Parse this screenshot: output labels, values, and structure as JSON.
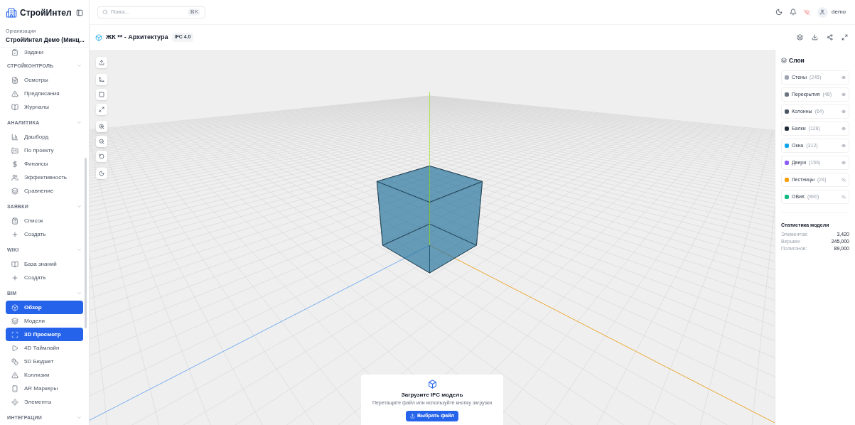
{
  "app": {
    "name": "СтройИнтел"
  },
  "search": {
    "placeholder": "Поиск...",
    "shortcut": "⌘K"
  },
  "user": {
    "name": "demo"
  },
  "organization": {
    "label": "Организация",
    "name": "СтройИнтел Демо (Минц..."
  },
  "sidebar": {
    "top_items": [
      {
        "label": "Задачи",
        "selected": false
      }
    ],
    "sections": [
      {
        "title": "СТРОЙКОНТРОЛЬ",
        "expanded": true,
        "items": [
          {
            "label": "Осмотры",
            "selected": false
          },
          {
            "label": "Предписания",
            "selected": false
          },
          {
            "label": "Журналы",
            "selected": false
          }
        ]
      },
      {
        "title": "АНАЛИТИКА",
        "expanded": true,
        "items": [
          {
            "label": "Дашборд",
            "selected": false
          },
          {
            "label": "По проекту",
            "selected": false
          },
          {
            "label": "Финансы",
            "selected": false
          },
          {
            "label": "Эффективность",
            "selected": false
          },
          {
            "label": "Сравнение",
            "selected": false
          }
        ]
      },
      {
        "title": "ЗАЯВКИ",
        "expanded": true,
        "items": [
          {
            "label": "Список",
            "selected": false
          },
          {
            "label": "Создать",
            "selected": false
          }
        ]
      },
      {
        "title": "WIKI",
        "expanded": true,
        "items": [
          {
            "label": "База знаний",
            "selected": false
          },
          {
            "label": "Создать",
            "selected": false
          }
        ]
      },
      {
        "title": "BIM",
        "expanded": true,
        "items": [
          {
            "label": "Обзор",
            "selected": true
          },
          {
            "label": "Модели",
            "selected": false
          },
          {
            "label": "3D Просмотр",
            "selected": true
          },
          {
            "label": "4D Таймлайн",
            "selected": false
          },
          {
            "label": "5D Бюджет",
            "selected": false
          },
          {
            "label": "Коллизии",
            "selected": false
          },
          {
            "label": "AR Маркеры",
            "selected": false
          },
          {
            "label": "Элементы",
            "selected": false
          }
        ]
      },
      {
        "title": "ИНТЕГРАЦИИ",
        "expanded": true
      }
    ]
  },
  "model": {
    "title": "ЖК ** - Архитектура",
    "badge": "IFC 4.0"
  },
  "upload": {
    "title": "Загрузите IFC модель",
    "subtitle": "Перетащите файл или используйте кнопку загрузки",
    "button": "Выбрать файл"
  },
  "layers": {
    "title": "Слои",
    "items": [
      {
        "name": "Стены",
        "count": "(245)",
        "color": "#9ca3af",
        "visible": true
      },
      {
        "name": "Перекрытия",
        "count": "(48)",
        "color": "#6b7280",
        "visible": true
      },
      {
        "name": "Колонны",
        "count": "(64)",
        "color": "#4b5563",
        "visible": true
      },
      {
        "name": "Балки",
        "count": "(128)",
        "color": "#1f2937",
        "visible": true
      },
      {
        "name": "Окна",
        "count": "(312)",
        "color": "#0ea5e9",
        "visible": true
      },
      {
        "name": "Двери",
        "count": "(156)",
        "color": "#8b5cf6",
        "visible": true
      },
      {
        "name": "Лестницы",
        "count": "(24)",
        "color": "#f59e0b",
        "visible": false
      },
      {
        "name": "ОВиК",
        "count": "(890)",
        "color": "#10b981",
        "visible": false
      }
    ]
  },
  "stats": {
    "title": "Статистика модели",
    "rows": [
      {
        "label": "Элементов:",
        "value": "3,420"
      },
      {
        "label": "Вершин:",
        "value": "245,000"
      },
      {
        "label": "Полигонов:",
        "value": "89,000"
      }
    ]
  }
}
